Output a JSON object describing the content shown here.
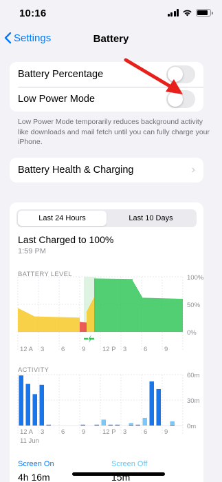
{
  "status_bar": {
    "time": "10:16",
    "signal_bars": 4,
    "battery_level": 0.86
  },
  "nav": {
    "back_label": "Settings",
    "title": "Battery"
  },
  "settings": {
    "battery_percentage": {
      "label": "Battery Percentage",
      "on": false
    },
    "low_power_mode": {
      "label": "Low Power Mode",
      "on": false
    },
    "footnote": "Low Power Mode temporarily reduces background activity like downloads and mail fetch until you can fully charge your iPhone.",
    "health_label": "Battery Health & Charging"
  },
  "usage": {
    "tabs": [
      {
        "label": "Last 24 Hours",
        "active": true
      },
      {
        "label": "Last 10 Days",
        "active": false
      }
    ],
    "last_charged_title": "Last Charged to 100%",
    "last_charged_time": "1:59 PM",
    "battery_section_label": "BATTERY LEVEL",
    "activity_section_label": "ACTIVITY",
    "legend": {
      "screen_on_label": "Screen On",
      "screen_on_value": "4h 16m",
      "screen_off_label": "Screen Off",
      "screen_off_value": "15m"
    }
  },
  "colors": {
    "accent": "#007aff",
    "battery_yellow": "#f7c928",
    "battery_green": "#34c759",
    "battery_red": "#e8403a",
    "activity_on": "#1a75e8",
    "activity_off": "#7cc7f5",
    "annotation_arrow": "#e8201c"
  },
  "chart_data": [
    {
      "type": "bar",
      "title": "BATTERY LEVEL",
      "y_ticks": [
        "100%",
        "50%",
        "0%"
      ],
      "ylim": [
        0,
        100
      ],
      "x_ticks": [
        "12 A",
        "3",
        "6",
        "9",
        "12 P",
        "3",
        "6",
        "9"
      ],
      "segments": [
        {
          "from_hour": 0,
          "to_hour": 2.5,
          "color_key": "battery_yellow",
          "start_level": 43,
          "end_level": 28
        },
        {
          "from_hour": 2.5,
          "to_hour": 9,
          "color_key": "battery_yellow",
          "start_level": 28,
          "end_level": 26
        },
        {
          "from_hour": 9,
          "to_hour": 10,
          "color_key": "battery_red",
          "start_level": 18,
          "end_level": 17
        },
        {
          "from_hour": 10,
          "to_hour": 11.1,
          "color_key": "battery_yellow",
          "start_level": 38,
          "end_level": 62
        },
        {
          "from_hour": 11.1,
          "to_hour": 16.7,
          "color_key": "battery_green",
          "start_level": 97,
          "end_level": 96
        },
        {
          "from_hour": 16.7,
          "to_hour": 18.2,
          "color_key": "battery_green",
          "start_level": 92,
          "end_level": 62
        },
        {
          "from_hour": 18.2,
          "to_hour": 24,
          "color_key": "battery_green",
          "start_level": 62,
          "end_level": 60
        }
      ],
      "charging_span_hours": [
        9.6,
        14.4
      ]
    },
    {
      "type": "bar",
      "title": "ACTIVITY",
      "y_ticks": [
        "60m",
        "30m",
        "0m"
      ],
      "ylim": [
        0,
        60
      ],
      "x_ticks": [
        "12 A",
        "3",
        "6",
        "9",
        "12 P",
        "3",
        "6",
        "9"
      ],
      "date_label": "11 Jun",
      "series": [
        {
          "name": "Screen On",
          "color_key": "activity_on",
          "values": [
            59,
            49,
            37,
            48,
            1,
            0,
            0,
            0,
            0,
            1,
            0,
            1,
            0,
            1,
            1,
            0,
            1,
            1,
            0,
            52,
            43,
            0,
            1,
            0
          ]
        },
        {
          "name": "Screen Off",
          "color_key": "activity_off",
          "values": [
            0,
            0,
            0,
            0,
            0,
            0,
            0,
            0,
            0,
            0,
            0,
            0,
            7,
            0,
            0,
            0,
            2,
            0,
            9,
            0,
            0,
            0,
            4,
            0
          ]
        }
      ]
    }
  ]
}
